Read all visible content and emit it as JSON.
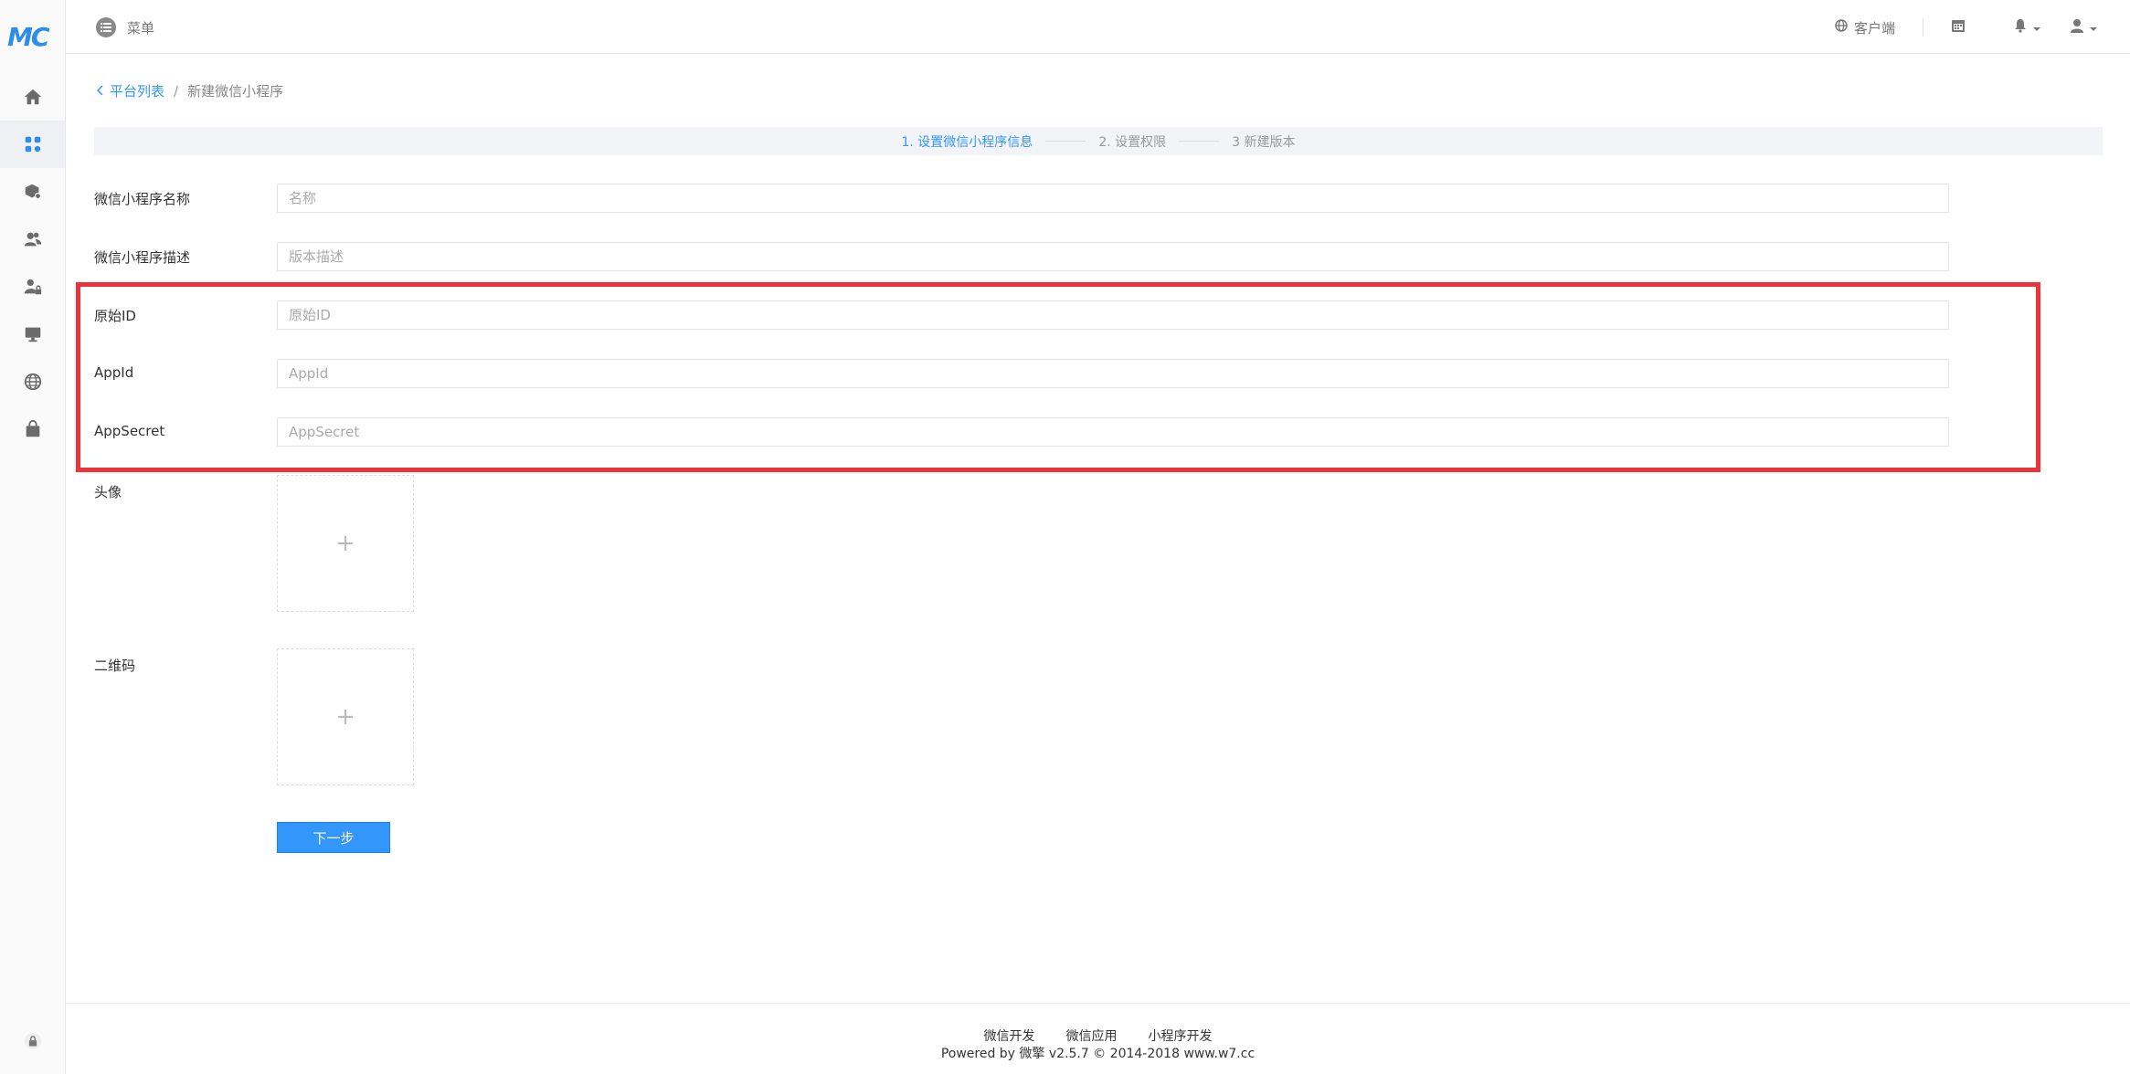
{
  "app": {
    "logo_text": "MC",
    "brand_color": "#2b8ee8"
  },
  "header": {
    "menu_label": "菜单",
    "client_label": "客户端"
  },
  "sidebar": {
    "icons": [
      "home-icon",
      "apps-icon",
      "box-settings-icon",
      "users-icon",
      "user-lock-icon",
      "monitor-icon",
      "globe-icon",
      "shop-bag-icon",
      "lock-icon"
    ]
  },
  "breadcrumb": {
    "back_label": "平台列表",
    "separator": "/",
    "current": "新建微信小程序"
  },
  "steps": [
    {
      "label": "1. 设置微信小程序信息",
      "active": true
    },
    {
      "label": "2. 设置权限",
      "active": false
    },
    {
      "label": "3 新建版本",
      "active": false
    }
  ],
  "form": {
    "name": {
      "label": "微信小程序名称",
      "placeholder": "名称"
    },
    "description": {
      "label": "微信小程序描述",
      "placeholder": "版本描述"
    },
    "original_id": {
      "label": "原始ID",
      "placeholder": "原始ID"
    },
    "appid": {
      "label": "AppId",
      "placeholder": "AppId"
    },
    "appsecret": {
      "label": "AppSecret",
      "placeholder": "AppSecret"
    },
    "avatar": {
      "label": "头像",
      "plus": "+"
    },
    "qrcode": {
      "label": "二维码",
      "plus": "+"
    },
    "next_label": "下一步"
  },
  "footer": {
    "links": [
      "微信开发",
      "微信应用",
      "小程序开发"
    ],
    "copyright": "Powered by 微擎 v2.5.7 © 2014-2018 www.w7.cc"
  },
  "colors": {
    "accent": "#3296fa",
    "highlight": "#ee3338"
  }
}
